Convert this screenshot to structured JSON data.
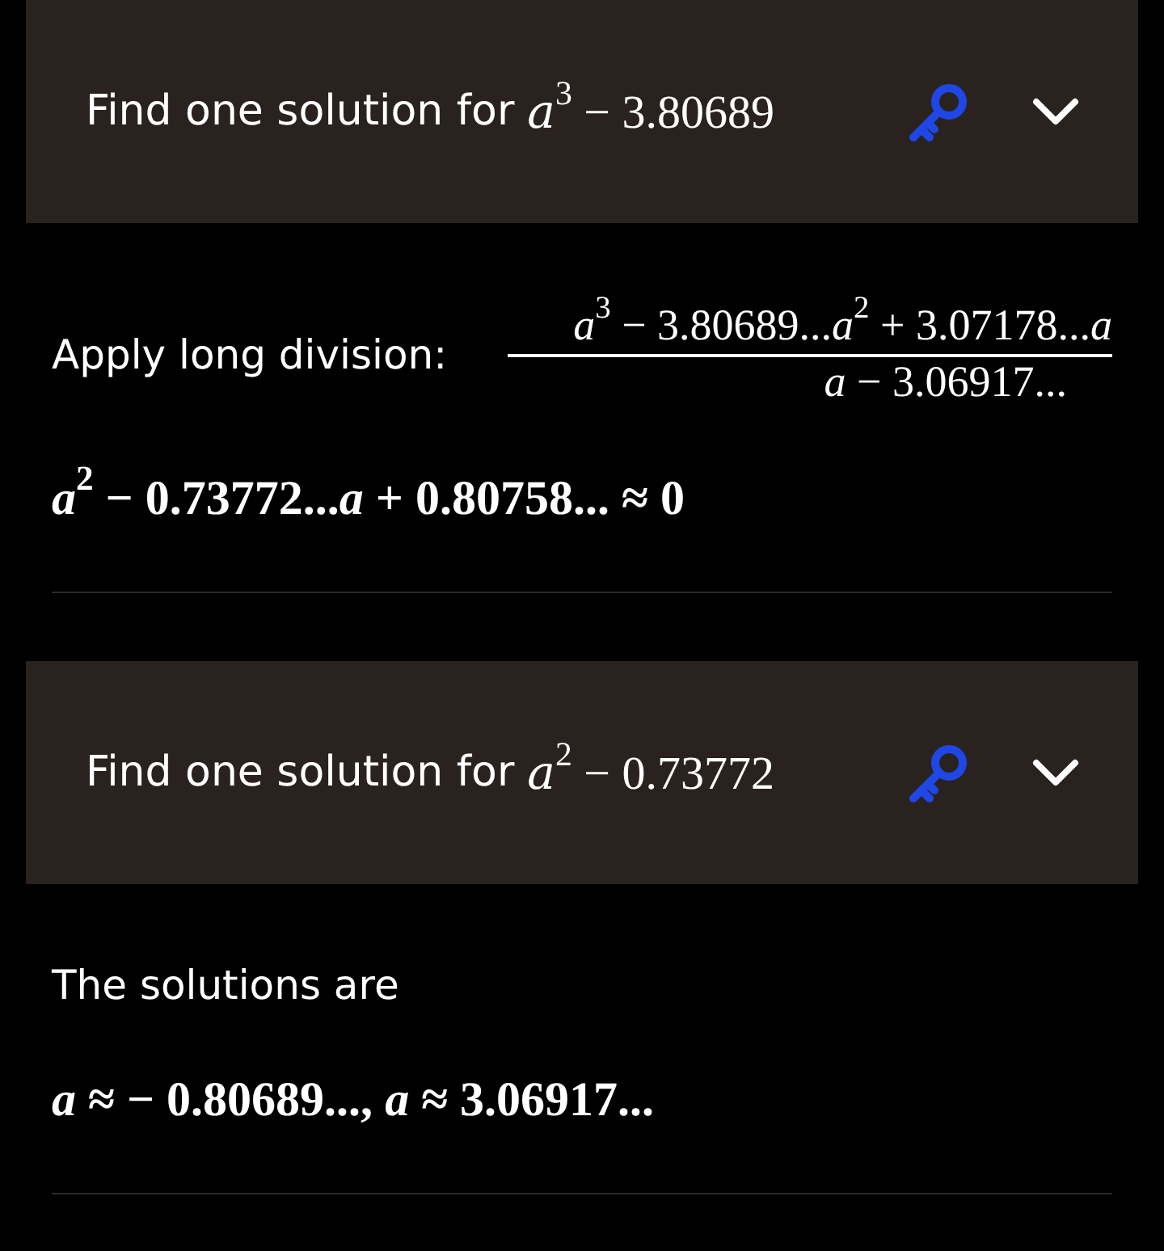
{
  "sections": [
    {
      "header": {
        "title": "Find one solution for",
        "expression": "*a*$^{3}$ − 3.80689"
      },
      "steps": [
        {
          "kind": "division",
          "label": "Apply long division:",
          "numerator": "*a*$^{3}$ − 3.80689...*a*$^{2}$ + 3.07178...*a*",
          "denominator": "*a* − 3.06917..."
        },
        {
          "kind": "formula",
          "text": "*a*$^{2}$ − 0.73772...*a* + 0.80758... ≈ 0"
        }
      ]
    },
    {
      "header": {
        "title": "Find one solution for",
        "expression": "*a*$^{2}$ − 0.73772"
      },
      "steps": [
        {
          "kind": "text",
          "text": "The solutions are"
        },
        {
          "kind": "formula",
          "text": "*a* ≈  − 0.80689..., *a* ≈ 3.06917..."
        }
      ]
    }
  ]
}
